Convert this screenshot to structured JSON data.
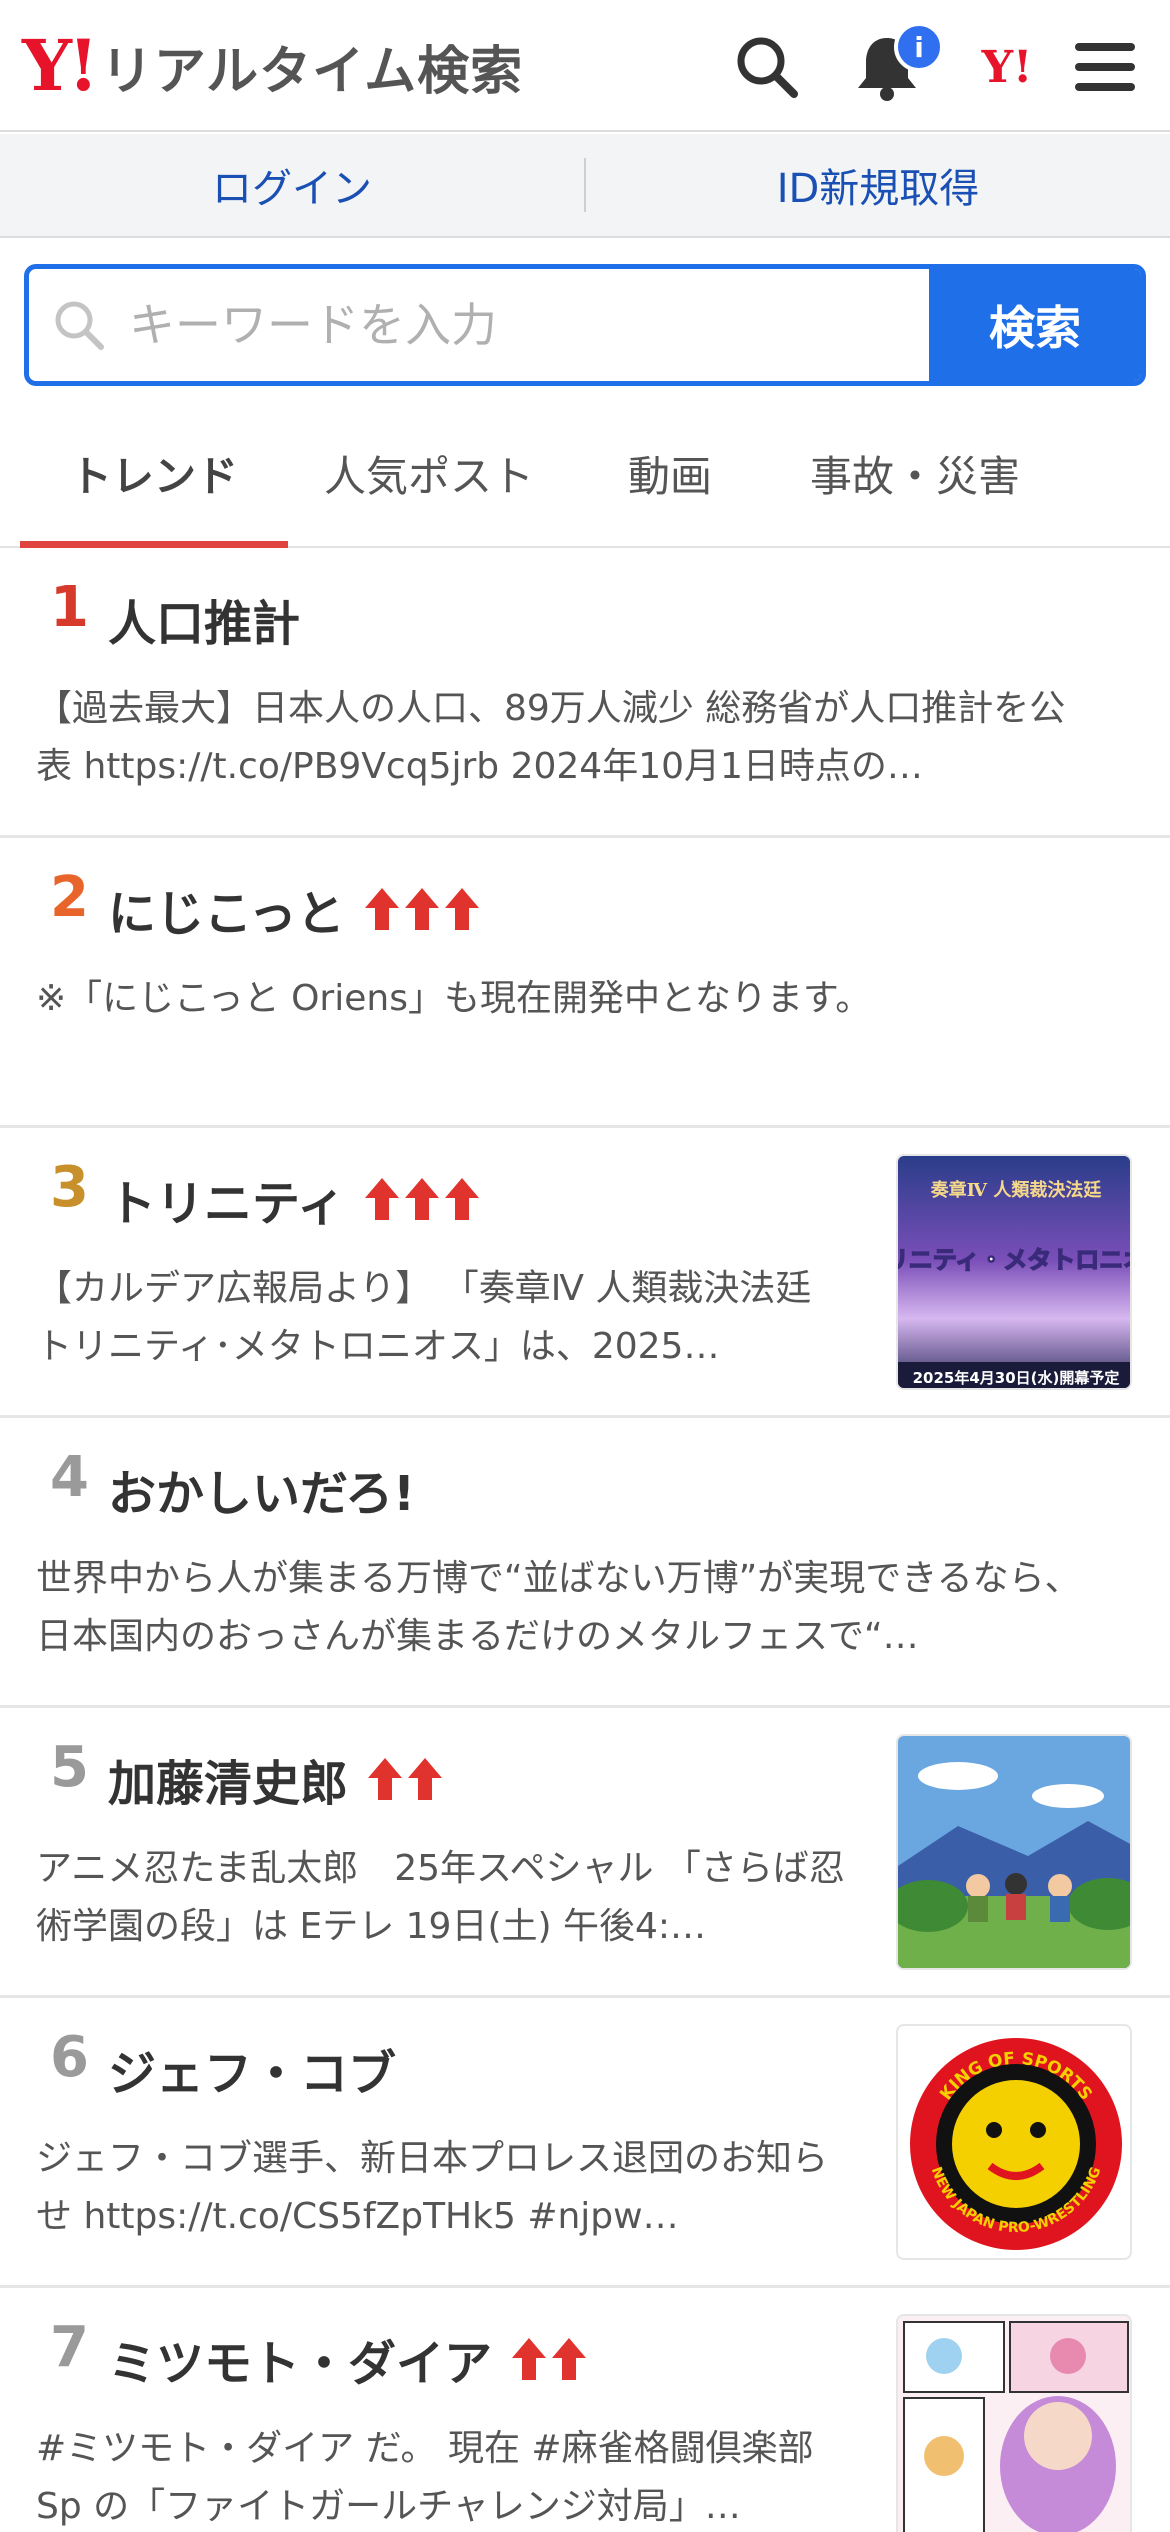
{
  "header": {
    "logo_mark": "Y!",
    "logo_text": "リアルタイム検索",
    "notification_badge": "i",
    "yahoo_mark": "Y!"
  },
  "loginbar": {
    "login": "ログイン",
    "register": "ID新規取得"
  },
  "search": {
    "placeholder": "キーワードを入力",
    "button": "検索"
  },
  "tabs": [
    "トレンド",
    "人気ポスト",
    "動画",
    "事故・災害"
  ],
  "colors": {
    "accent_blue": "#1f6fe8",
    "brand_red": "#e6132b",
    "rank1": "#d63a2a",
    "rank2": "#e8642a",
    "rank3": "#c8902a",
    "rank_other": "#9a9a9a",
    "arrow_red": "#e0332e"
  },
  "trends": [
    {
      "rank": "1",
      "title": "人口推計",
      "arrows": 0,
      "desc": "【過去最大】日本人の人口、89万人減少 総務省が人口推計を公表 https://t.co/PB9Vcq5jrb 2024年10月1日時点の…",
      "thumb": null
    },
    {
      "rank": "2",
      "title": "にじこっと",
      "arrows": 3,
      "desc": "※「にじこっと Oriens」も現在開発中となります。",
      "thumb": null
    },
    {
      "rank": "3",
      "title": "トリニティ",
      "arrows": 3,
      "desc": "【カルデア広報局より】 「奏章Ⅳ 人類裁決法廷 トリニティ･メタトロニオス」は、2025…",
      "thumb": "fgo-banner",
      "thumb_text": {
        "top": "奏章Ⅳ 人類裁決法廷",
        "main": "トリニティ・メタトロニオス",
        "date": "2025年4月30日(水)開幕予定"
      }
    },
    {
      "rank": "4",
      "title": "おかしいだろ!",
      "arrows": 0,
      "desc": "世界中から人が集まる万博で“並ばない万博”が実現できるなら、日本国内のおっさんが集まるだけのメタルフェスで“…",
      "thumb": null
    },
    {
      "rank": "5",
      "title": "加藤清史郎",
      "arrows": 2,
      "desc": "アニメ忍たま乱太郎　25年スペシャル 「さらば忍術学園の段」は Eテレ 19日(土) 午後4:…",
      "thumb": "anime-scene"
    },
    {
      "rank": "6",
      "title": "ジェフ・コブ",
      "arrows": 0,
      "desc": "ジェフ・コブ選手、新日本プロレス退団のお知らせ https://t.co/CS5fZpTHk5 #njpw…",
      "thumb": "njpw-logo",
      "thumb_text": {
        "top": "KING OF SPORTS",
        "bottom": "NEW JAPAN PRO-WRESTLING"
      }
    },
    {
      "rank": "7",
      "title": "ミツモト・ダイア",
      "arrows": 2,
      "desc": "#ミツモト・ダイア だ。 現在 #麻雀格闘倶楽部Sp の「ファイトガールチャレンジ対局」…",
      "thumb": "manga-art"
    }
  ]
}
